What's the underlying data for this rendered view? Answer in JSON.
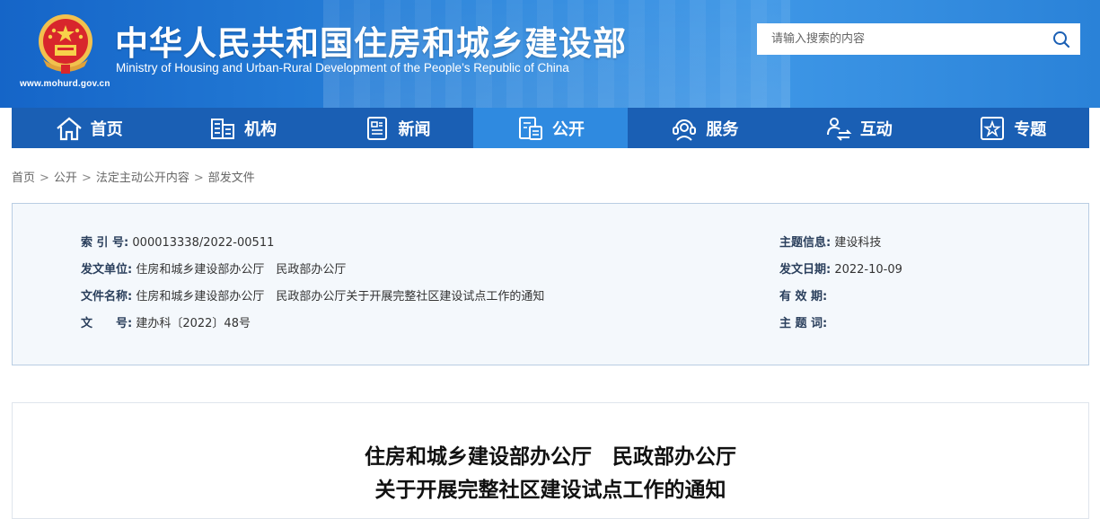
{
  "header": {
    "title_cn": "中华人民共和国住房和城乡建设部",
    "title_en": "Ministry of Housing and Urban-Rural Development of the People’s Republic of China",
    "site_url": "www.mohurd.gov.cn",
    "emblem_icon": "national-emblem-icon"
  },
  "search": {
    "placeholder": "请输入搜索的内容",
    "icon": "search-icon"
  },
  "nav": {
    "items": [
      {
        "label": "首页",
        "icon": "home-icon"
      },
      {
        "label": "机构",
        "icon": "organization-icon"
      },
      {
        "label": "新闻",
        "icon": "news-icon"
      },
      {
        "label": "公开",
        "icon": "disclosure-icon"
      },
      {
        "label": "服务",
        "icon": "service-icon"
      },
      {
        "label": "互动",
        "icon": "interaction-icon"
      },
      {
        "label": "专题",
        "icon": "topic-icon"
      }
    ],
    "active_index": 3
  },
  "breadcrumb": {
    "items": [
      "首页",
      "公开",
      "法定主动公开内容",
      "部发文件"
    ],
    "separator": ">"
  },
  "meta": {
    "index_label": "索 引 号:",
    "index_value": "000013338/2022-00511",
    "topic_label": "主题信息:",
    "topic_value": "建设科技",
    "issuer_label": "发文单位:",
    "issuer_value": "住房和城乡建设部办公厅　民政部办公厅",
    "date_label": "发文日期:",
    "date_value": "2022-10-09",
    "filename_label": "文件名称:",
    "filename_value": "住房和城乡建设部办公厅　民政部办公厅关于开展完整社区建设试点工作的通知",
    "validity_label": "有 效 期:",
    "validity_value": "",
    "docno_label": "文　　号:",
    "docno_value": "建办科〔2022〕48号",
    "keywords_label": "主 题 词:",
    "keywords_value": ""
  },
  "article": {
    "title_line1": "住房和城乡建设部办公厅　民政部办公厅",
    "title_line2": "关于开展完整社区建设试点工作的通知"
  },
  "colors": {
    "header_blue": "#1565c8",
    "nav_blue": "#1a5fb4",
    "nav_active": "#2f8ae0",
    "meta_bg": "#f4f8fc"
  }
}
